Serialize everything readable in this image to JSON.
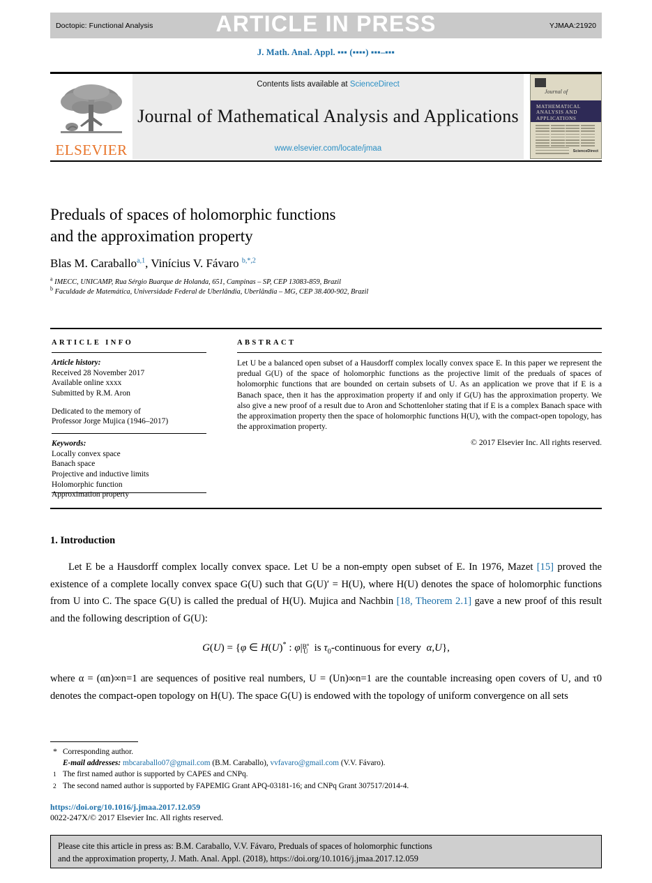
{
  "press_band": {
    "doctopic": "Doctopic: Functional Analysis",
    "stamp": "ARTICLE IN PRESS",
    "article_id": "YJMAA:21920"
  },
  "journal_ref": "J. Math. Anal. Appl. ▪▪▪ (▪▪▪▪) ▪▪▪–▪▪▪",
  "masthead": {
    "contents_prefix": "Contents lists available at ",
    "sciencedirect": "ScienceDirect",
    "journal_title": "Journal of Mathematical Analysis and Applications",
    "journal_url": "www.elsevier.com/locate/jmaa",
    "publisher_wordmark": "ELSEVIER",
    "cover": {
      "script": "Journal of",
      "line1": "MATHEMATICAL",
      "line2": "ANALYSIS AND",
      "line3": "APPLICATIONS",
      "badge": "ScienceDirect"
    }
  },
  "article": {
    "title_line1": "Preduals of spaces of holomorphic functions",
    "title_line2": "and the approximation property",
    "authors": [
      {
        "name": "Blas M. Caraballo",
        "marks": "a,1"
      },
      {
        "name": "Vinícius V. Fávaro",
        "marks": "b,*,2"
      }
    ],
    "affiliations": [
      {
        "mark": "a",
        "text": "IMECC, UNICAMP, Rua Sérgio Buarque de Holanda, 651, Campinas – SP, CEP 13083-859, Brazil"
      },
      {
        "mark": "b",
        "text": "Faculdade de Matemática, Universidade Federal de Uberlândia, Uberlândia – MG, CEP 38.400-902, Brazil"
      }
    ]
  },
  "info": {
    "heading": "ARTICLE INFO",
    "history_label": "Article history:",
    "history": [
      "Received 28 November 2017",
      "Available online xxxx",
      "Submitted by R.M. Aron"
    ],
    "dedication": [
      "Dedicated to the memory of",
      "Professor Jorge Mujica (1946–2017)"
    ],
    "keywords_label": "Keywords:",
    "keywords": [
      "Locally convex space",
      "Banach space",
      "Projective and inductive limits",
      "Holomorphic function",
      "Approximation property"
    ]
  },
  "abstract": {
    "heading": "ABSTRACT",
    "body": "Let U be a balanced open subset of a Hausdorff complex locally convex space E. In this paper we represent the predual G(U) of the space of holomorphic functions as the projective limit of the preduals of spaces of holomorphic functions that are bounded on certain subsets of U. As an application we prove that if E is a Banach space, then it has the approximation property if and only if G(U) has the approximation property. We also give a new proof of a result due to Aron and Schottenloher stating that if E is a complex Banach space with the approximation property then the space of holomorphic functions H(U), with the compact-open topology, has the approximation property.",
    "copyright": "© 2017 Elsevier Inc. All rights reserved."
  },
  "body": {
    "section_heading": "1. Introduction",
    "para1_a": "Let E be a Hausdorff complex locally convex space. Let U be a non-empty open subset of E. In 1976, Mazet ",
    "cite1": "[15]",
    "para1_b": " proved the existence of a complete locally convex space G(U) such that G(U)′ = H(U), where H(U) denotes the space of holomorphic functions from U into C. The space G(U) is called the predual of H(U). Mujica and Nachbin ",
    "cite2": "[18, Theorem 2.1]",
    "para1_c": " gave a new proof of this result and the following description of G(U):",
    "equation": "G(U) = {φ ∈ H(U)* : φ|B^α_U   is τ0-continuous for every  α,U},",
    "para2": "where α = (αn)∞n=1 are sequences of positive real numbers, U = (Un)∞n=1 are the countable increasing open covers of U, and τ0 denotes the compact-open topology on H(U). The space G(U) is endowed with the topology of uniform convergence on all sets"
  },
  "footnotes": {
    "corresponding": {
      "mark": "*",
      "text": "Corresponding author."
    },
    "email_label": "E-mail addresses:",
    "email1": "mbcaraballo07@gmail.com",
    "email1_who": "(B.M. Caraballo),",
    "email2": "vvfavaro@gmail.com",
    "email2_who": "(V.V. Fávaro).",
    "note1": {
      "mark": "1",
      "text": "The first named author is supported by CAPES and CNPq."
    },
    "note2": {
      "mark": "2",
      "text": "The second named author is supported by FAPEMIG Grant APQ-03181-16; and CNPq Grant 307517/2014-4."
    },
    "doi": "https://doi.org/10.1016/j.jmaa.2017.12.059",
    "issn": "0022-247X/© 2017 Elsevier Inc. All rights reserved."
  },
  "cite_box": {
    "line1": "Please cite this article in press as: B.M. Caraballo, V.V. Fávaro, Preduals of spaces of holomorphic functions",
    "line2": "and the approximation property, J. Math. Anal. Appl. (2018), https://doi.org/10.1016/j.jmaa.2017.12.059"
  },
  "colors": {
    "link": "#1a6ea8",
    "elsevier_orange": "#e8742a",
    "band_gray": "#c9c9c9",
    "masthead_gray": "#ececec"
  }
}
